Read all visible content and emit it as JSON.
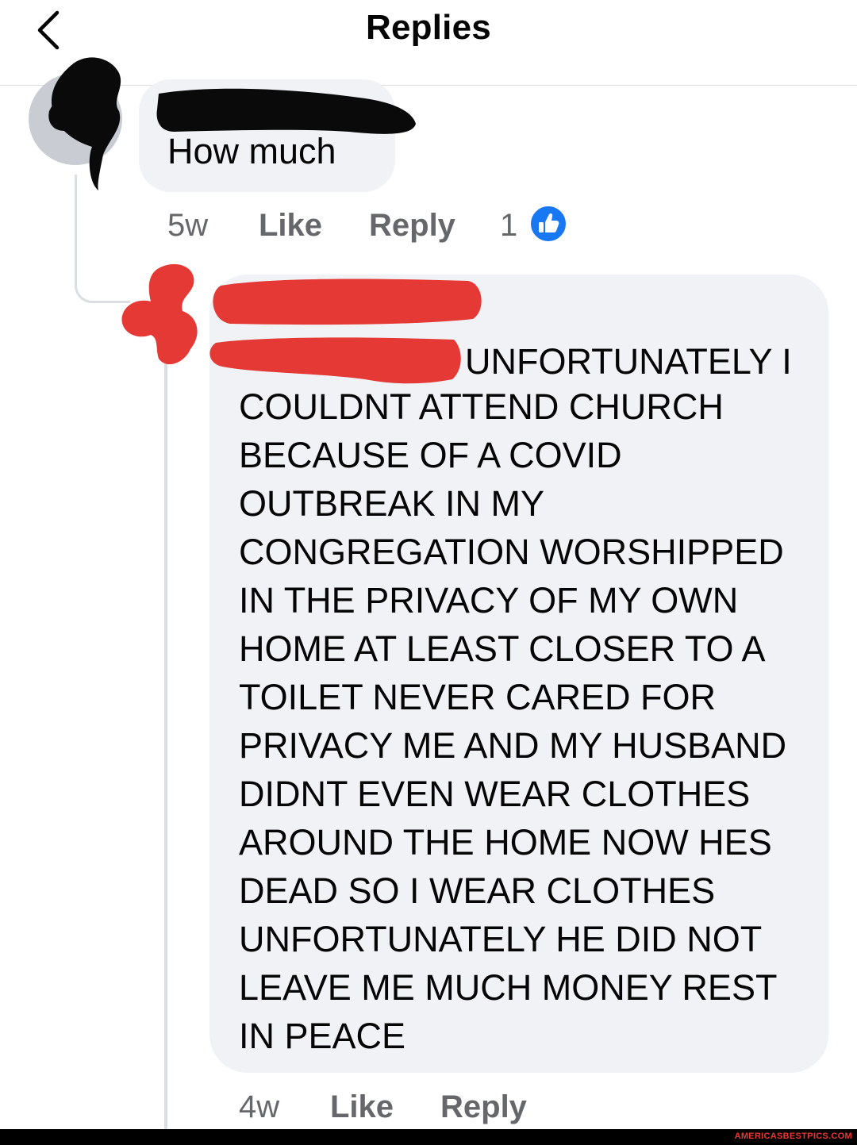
{
  "header": {
    "title": "Replies"
  },
  "comments": [
    {
      "author_redacted": true,
      "text": "How much",
      "time": "5w",
      "like_label": "Like",
      "reply_label": "Reply",
      "reaction_count": "1",
      "reaction_icon": "thumbs-up-icon"
    },
    {
      "author_redacted": true,
      "first_line": "UNFORTUNATELY I",
      "lines": [
        "COULDNT ATTEND CHURCH",
        "BECAUSE OF A COVID",
        "OUTBREAK IN MY",
        "CONGREGATION WORSHIPPED",
        "IN THE PRIVACY OF MY OWN",
        "HOME AT LEAST CLOSER TO A",
        "TOILET NEVER CARED FOR",
        "PRIVACY ME AND MY HUSBAND",
        "DIDNT EVEN WEAR CLOTHES",
        "AROUND THE HOME NOW HES",
        "DEAD SO I WEAR CLOTHES",
        "UNFORTUNATELY HE DID NOT",
        "LEAVE ME MUCH MONEY REST",
        "IN PEACE"
      ],
      "time": "4w",
      "like_label": "Like",
      "reply_label": "Reply"
    }
  ],
  "watermark": "AMERICASBESTPICS.COM",
  "colors": {
    "bubble": "#f0f2f5",
    "meta_text": "#65676b",
    "reaction_blue": "#1877f2",
    "redaction_black": "#0a0a0a",
    "redaction_red": "#e53935"
  }
}
